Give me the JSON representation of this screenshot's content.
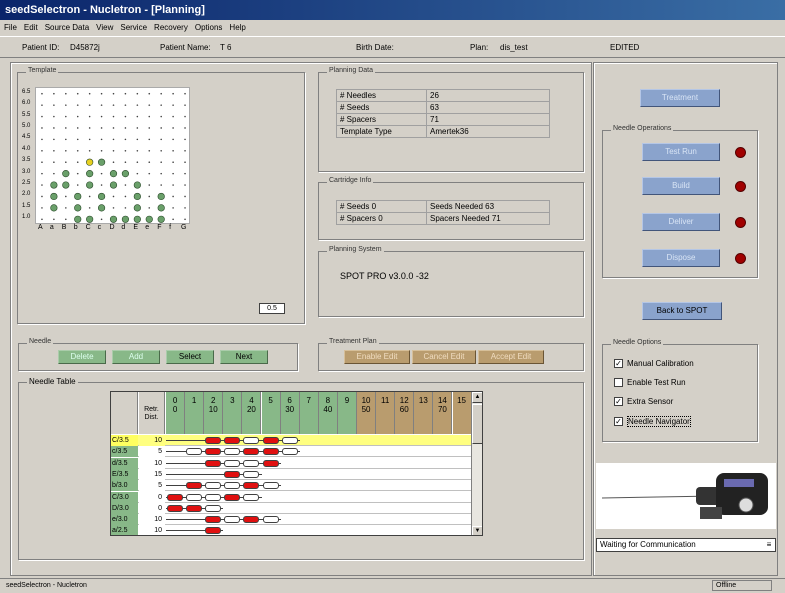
{
  "window": {
    "title": "seedSelectron - Nucletron - [Planning]"
  },
  "menu": [
    "File",
    "Edit",
    "Source Data",
    "View",
    "Service",
    "Recovery",
    "Options",
    "Help"
  ],
  "info": {
    "patient_id_label": "Patient ID:",
    "patient_id": "D45872j",
    "patient_name_label": "Patient Name:",
    "patient_name": "T 6",
    "birth_date_label": "Birth Date:",
    "plan_label": "Plan:",
    "plan": "dis_test",
    "status": "EDITED"
  },
  "template": {
    "label": "Template",
    "y_labels": [
      "6.5",
      "6.0",
      "5.5",
      "5.0",
      "4.5",
      "4.0",
      "3.5",
      "3.0",
      "2.5",
      "2.0",
      "1.5",
      "1.0"
    ],
    "x_labels": [
      "A",
      "a",
      "B",
      "b",
      "C",
      "c",
      "D",
      "d",
      "E",
      "e",
      "F",
      "f",
      "G"
    ],
    "scale_label": "0.5"
  },
  "planning_data": {
    "label": "Planning Data",
    "rows": [
      [
        "# Needles",
        "26"
      ],
      [
        "# Seeds",
        "63"
      ],
      [
        "# Spacers",
        "71"
      ],
      [
        "Template Type",
        "Amertek36"
      ]
    ]
  },
  "cartridge": {
    "label": "Cartridge Info",
    "rows": [
      [
        "# Seeds 0",
        "Seeds Needed 63"
      ],
      [
        "# Spacers 0",
        "Spacers Needed 71"
      ]
    ]
  },
  "planning_system": {
    "label": "Planning System",
    "value": "SPOT PRO v3.0.0 -32"
  },
  "needle": {
    "label": "Needle",
    "buttons": [
      "Delete",
      "Add",
      "Select",
      "Next"
    ]
  },
  "treatment_plan": {
    "label": "Treatment Plan",
    "buttons": [
      "Enable Edit",
      "Cancel Edit",
      "Accept Edit"
    ]
  },
  "needle_table": {
    "label": "Needle Table",
    "header_left": "Retr. Dist.",
    "col_top": [
      "0",
      "1",
      "2",
      "3",
      "4",
      "5",
      "6",
      "7",
      "8",
      "9",
      "10",
      "11",
      "12",
      "13",
      "14",
      "15"
    ],
    "col_bottom": [
      "0",
      "",
      "10",
      "",
      "20",
      "",
      "30",
      "",
      "40",
      "",
      "50",
      "",
      "60",
      "",
      "70",
      ""
    ],
    "rows": [
      {
        "name": "C/3.5",
        "dist": "10",
        "sel": true,
        "segs": [
          [
            2,
            "r"
          ],
          [
            3,
            "r"
          ],
          [
            4,
            "w"
          ],
          [
            5,
            "r"
          ],
          [
            6,
            "w"
          ]
        ]
      },
      {
        "name": "c/3.5",
        "dist": "5",
        "segs": [
          [
            1,
            "w"
          ],
          [
            2,
            "r"
          ],
          [
            3,
            "w"
          ],
          [
            4,
            "r"
          ],
          [
            5,
            "r"
          ],
          [
            6,
            "w"
          ]
        ]
      },
      {
        "name": "d/3.5",
        "dist": "10",
        "segs": [
          [
            2,
            "r"
          ],
          [
            3,
            "w"
          ],
          [
            4,
            "w"
          ],
          [
            5,
            "r"
          ]
        ]
      },
      {
        "name": "E/3.5",
        "dist": "15",
        "segs": [
          [
            3,
            "r"
          ],
          [
            4,
            "w"
          ]
        ]
      },
      {
        "name": "b/3.0",
        "dist": "5",
        "segs": [
          [
            1,
            "r"
          ],
          [
            2,
            "w"
          ],
          [
            3,
            "w"
          ],
          [
            4,
            "r"
          ],
          [
            5,
            "w"
          ]
        ]
      },
      {
        "name": "C/3.0",
        "dist": "0",
        "segs": [
          [
            0,
            "r"
          ],
          [
            1,
            "w"
          ],
          [
            2,
            "w"
          ],
          [
            3,
            "r"
          ],
          [
            4,
            "w"
          ]
        ]
      },
      {
        "name": "D/3.0",
        "dist": "0",
        "segs": [
          [
            0,
            "r"
          ],
          [
            1,
            "r"
          ],
          [
            2,
            "w"
          ]
        ]
      },
      {
        "name": "e/3.0",
        "dist": "10",
        "segs": [
          [
            2,
            "r"
          ],
          [
            3,
            "w"
          ],
          [
            4,
            "r"
          ],
          [
            5,
            "w"
          ]
        ]
      },
      {
        "name": "a/2.5",
        "dist": "10",
        "segs": [
          [
            2,
            "r"
          ]
        ]
      }
    ]
  },
  "right": {
    "treatment": "Treatment",
    "needle_ops_label": "Needle Operations",
    "ops": [
      "Test Run",
      "Build",
      "Deliver",
      "Dispose"
    ],
    "back": "Back to SPOT",
    "needle_options_label": "Needle Options",
    "options": [
      {
        "label": "Manual Calibration",
        "checked": true
      },
      {
        "label": "Enable Test Run",
        "checked": false
      },
      {
        "label": "Extra Sensor",
        "checked": true
      },
      {
        "label": "Needle Navigator",
        "checked": true
      }
    ],
    "comm": "Waiting for Communication"
  },
  "status": {
    "left": "seedSelectron - Nucletron",
    "right": "Offline"
  }
}
